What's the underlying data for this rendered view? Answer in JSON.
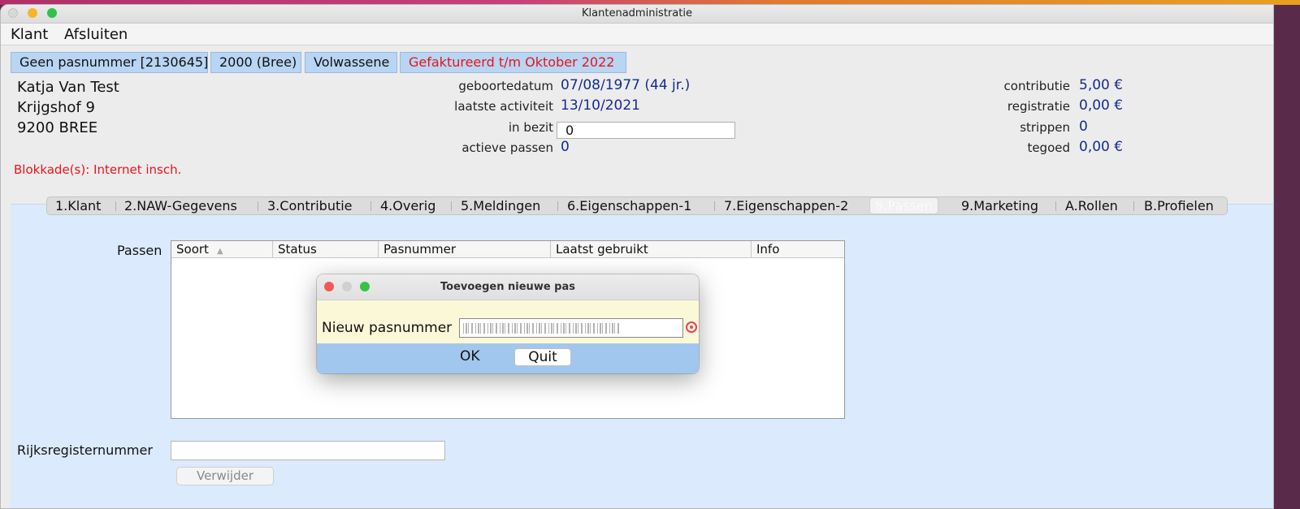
{
  "window": {
    "title": "Klantenadministratie"
  },
  "menu": {
    "items": [
      "Klant",
      "Afsluiten"
    ]
  },
  "badges": [
    {
      "label": "Geen pasnummer [2130645]",
      "color": "#111111"
    },
    {
      "label": "2000 (Bree)",
      "color": "#111111"
    },
    {
      "label": "Volwassene",
      "color": "#111111"
    },
    {
      "label": "Gefaktureerd t/m Oktober 2022",
      "color": "#e8141a"
    }
  ],
  "customer": {
    "name": "Katja Van Test",
    "street": "Krijgshof 9",
    "city": "9200 BREE",
    "blokkade": "Blokkade(s): Internet insch."
  },
  "details": {
    "geboortedatum_label": "geboortedatum",
    "geboortedatum_value": "07/08/1977 (44 jr.)",
    "laatste_activiteit_label": "laatste activiteit",
    "laatste_activiteit_value": "13/10/2021",
    "in_bezit_label": "in bezit",
    "in_bezit_value": "0",
    "actieve_passen_label": "actieve passen",
    "actieve_passen_value": "0"
  },
  "finance": {
    "contributie_label": "contributie",
    "contributie_value": "5,00 €",
    "registratie_label": "registratie",
    "registratie_value": "0,00 €",
    "strippen_label": "strippen",
    "strippen_value": "0",
    "tegoed_label": "tegoed",
    "tegoed_value": "0,00 €"
  },
  "tabs": [
    "1.Klant",
    "2.NAW-Gegevens",
    "3.Contributie",
    "4.Overig",
    "5.Meldingen",
    "6.Eigenschappen-1",
    "7.Eigenschappen-2",
    "8.Passen",
    "9.Marketing",
    "A.Rollen",
    "B.Profielen"
  ],
  "active_tab": "8.Passen",
  "passen": {
    "label": "Passen",
    "columns": [
      "Soort",
      "Status",
      "Pasnummer",
      "Laatst gebruikt",
      "Info"
    ],
    "sort_indicator": "▲"
  },
  "rijksregister": {
    "label": "Rijksregisternummer",
    "value": ""
  },
  "verwijder_label": "Verwijder",
  "dialog": {
    "title": "Toevoegen nieuwe pas",
    "field_label": "Nieuw pasnummer",
    "ok_label": "OK",
    "quit_label": "Quit"
  }
}
